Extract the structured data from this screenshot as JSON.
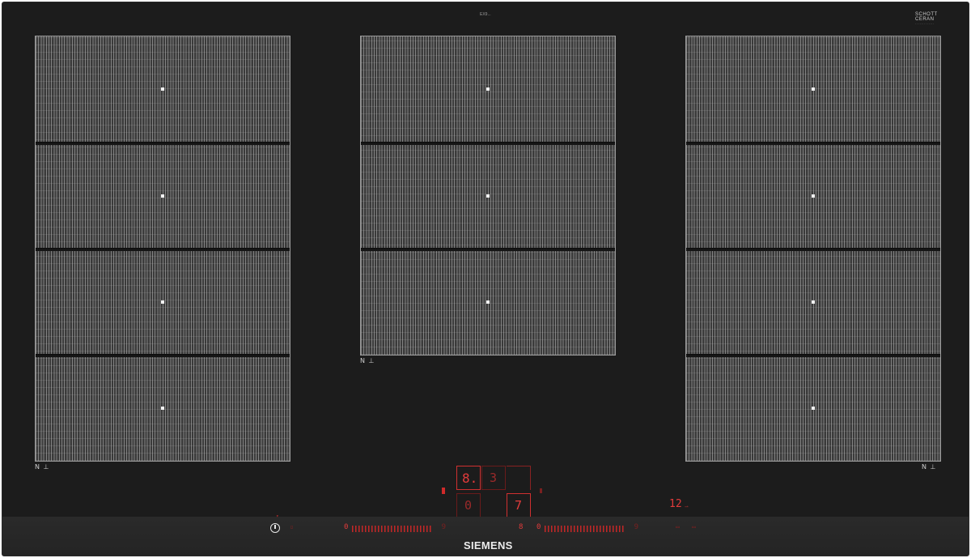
{
  "top": {
    "model_label": "EX9...",
    "schott_line1": "SCHOTT",
    "schott_line2": "CERAN",
    "schott_line3": "·············"
  },
  "zones": {
    "mark": "N ⊥"
  },
  "controls": {
    "display_main": "8.",
    "display_level": "3",
    "display_zero": "0",
    "display_seven": "7",
    "timer_value": "12",
    "power_icon": "power-icon",
    "left_scale_min": "0",
    "left_scale_max": "9",
    "right_scale_min": "0",
    "right_scale_max": "9",
    "brand": "SIEMENS",
    "accent_color": "#e33b3b"
  }
}
